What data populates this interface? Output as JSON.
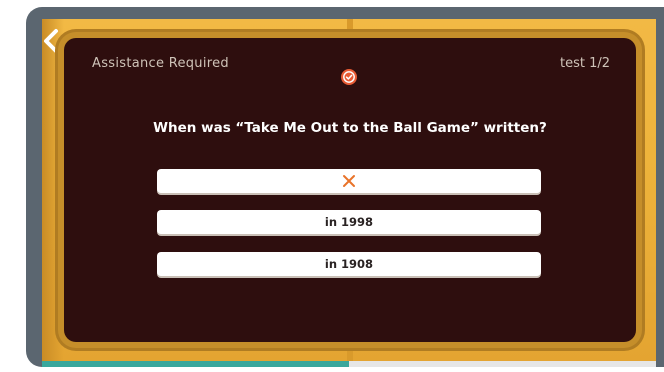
{
  "header": {
    "title": "Assistance Required",
    "counter": "test 1/2"
  },
  "question": {
    "text": "When was “Take Me Out to the Ball Game” written?"
  },
  "answers": [
    {
      "label": "",
      "state": "wrong",
      "icon": "x-mark-icon"
    },
    {
      "label": "in 1998",
      "state": "default"
    },
    {
      "label": "in 1908",
      "state": "default"
    }
  ],
  "progress": {
    "fraction": 0.5
  },
  "colors": {
    "frame": "#5b6670",
    "gold": "#f2b945",
    "panel": "#2e0e0e",
    "wrong": "#e8732a",
    "badge": "#e85b34",
    "progress": "#3aa79c"
  },
  "icons": {
    "back": "chevron-left-icon",
    "badge": "check-circle-icon"
  }
}
